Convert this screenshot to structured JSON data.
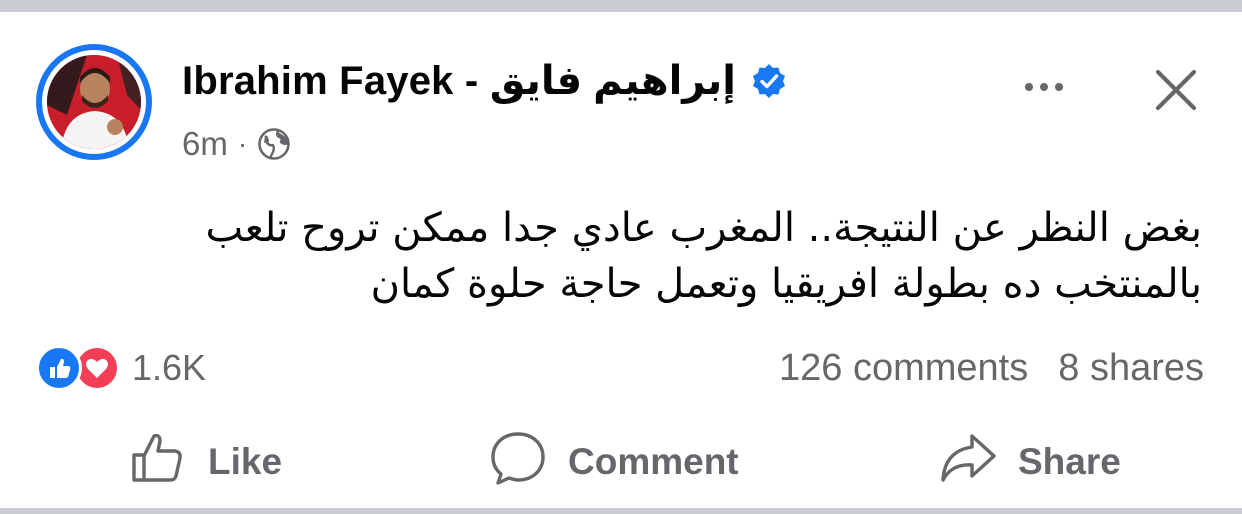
{
  "post": {
    "author_name": "Ibrahim Fayek - إبراهيم  فايق",
    "time": "6m",
    "separator": "·",
    "text_line1": "بغض النظر عن النتيجة.. المغرب عادي جدا ممكن تروح تلعب",
    "text_line2": "بالمنتخب ده بطولة افريقيا وتعمل حاجة حلوة كمان",
    "icons": {
      "verified": "verified-badge-icon",
      "audience": "globe-icon",
      "more": "more-options-icon",
      "close": "close-icon"
    }
  },
  "engagement": {
    "reaction_count": "1.6K",
    "comments": "126 comments",
    "shares": "8 shares",
    "reaction_icons": [
      "like-reaction-icon",
      "love-reaction-icon"
    ]
  },
  "actions": {
    "like_label": "Like",
    "comment_label": "Comment",
    "share_label": "Share"
  },
  "colors": {
    "brand_blue": "#1877f2",
    "love_red": "#f33e58",
    "secondary_text": "#65676b",
    "primary_text": "#050505"
  }
}
